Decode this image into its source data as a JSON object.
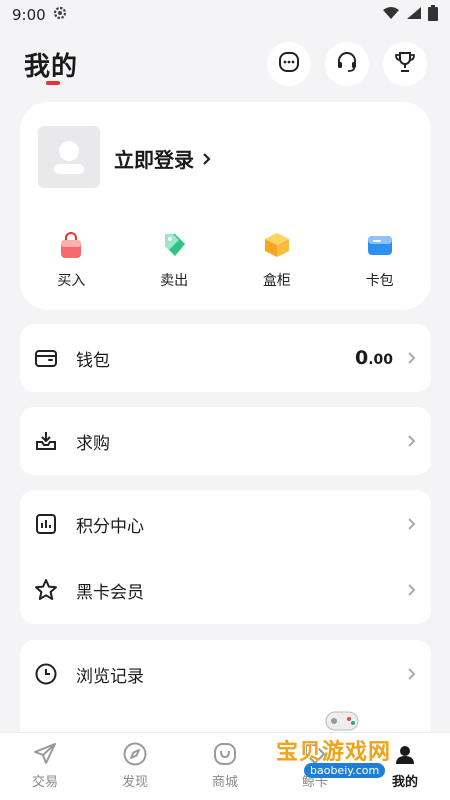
{
  "status_bar": {
    "time": "9:00"
  },
  "header": {
    "title": "我的"
  },
  "profile": {
    "login_label": "立即登录"
  },
  "quick_actions": [
    {
      "label": "买入",
      "icon": "bag-icon"
    },
    {
      "label": "卖出",
      "icon": "tag-icon"
    },
    {
      "label": "盒柜",
      "icon": "box-icon"
    },
    {
      "label": "卡包",
      "icon": "card-icon"
    }
  ],
  "wallet": {
    "label": "钱包",
    "value_int": "0",
    "value_dec": ".00"
  },
  "wanted": {
    "label": "求购"
  },
  "points": {
    "label": "积分中心"
  },
  "black_card": {
    "label": "黑卡会员"
  },
  "history": {
    "label": "浏览记录"
  },
  "bottom_nav": [
    {
      "label": "交易",
      "icon": "send-icon"
    },
    {
      "label": "发现",
      "icon": "compass-icon"
    },
    {
      "label": "商城",
      "icon": "shop-icon"
    },
    {
      "label": "鲸卡",
      "icon": "tag-icon"
    },
    {
      "label": "我的",
      "icon": "profile-icon"
    }
  ],
  "watermark": {
    "title": "宝贝游戏网",
    "url": "baobeiy.com"
  },
  "colors": {
    "accent": "#e8322f",
    "background": "#f4f4f6",
    "card": "#ffffff"
  }
}
